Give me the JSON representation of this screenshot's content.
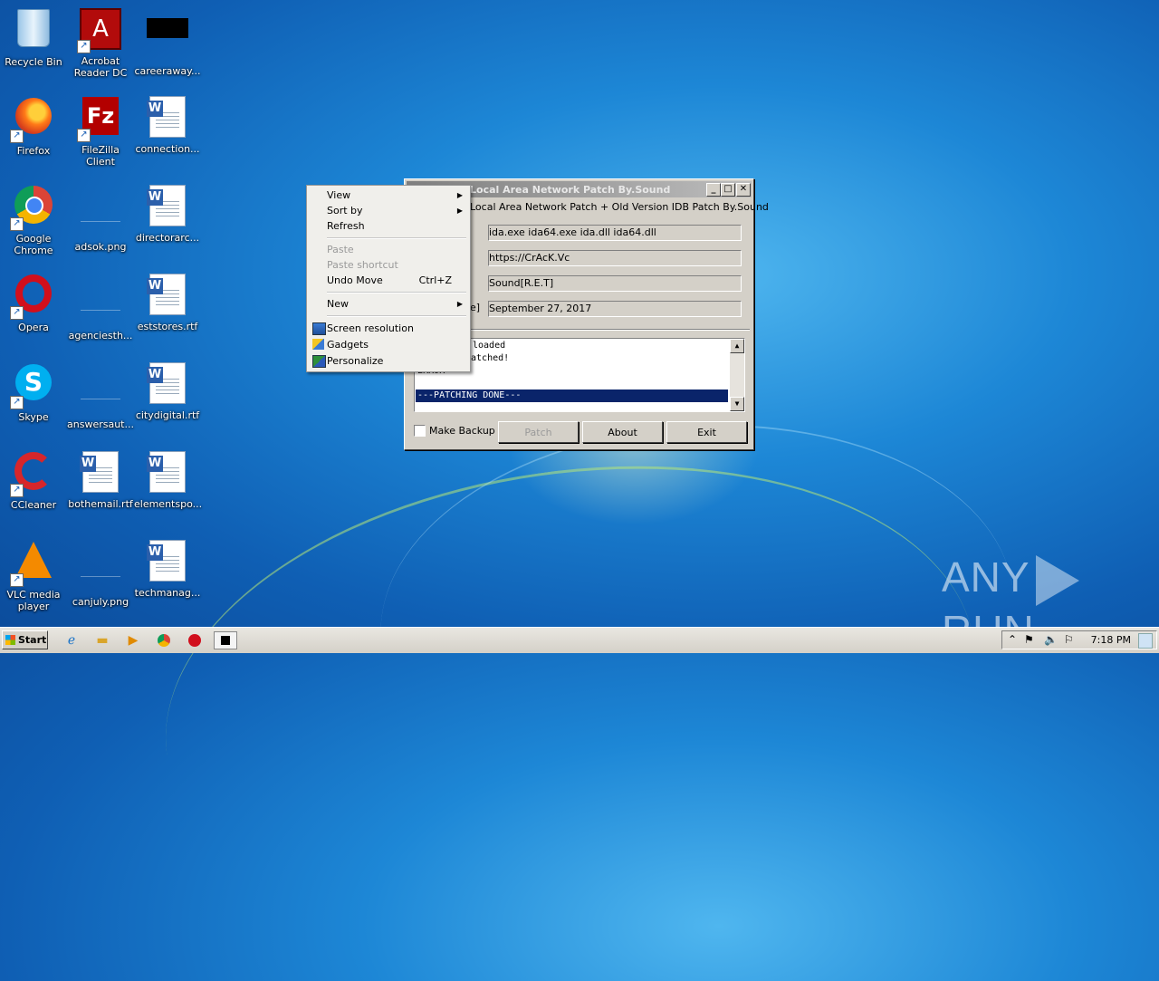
{
  "desktop": {
    "icons": [
      {
        "label": "Recycle Bin"
      },
      {
        "label": "Acrobat Reader DC"
      },
      {
        "label": "careeraway..."
      },
      {
        "label": "Firefox"
      },
      {
        "label": "FileZilla Client"
      },
      {
        "label": "connection..."
      },
      {
        "label": "Google Chrome"
      },
      {
        "label": "adsok.png"
      },
      {
        "label": "directorarc..."
      },
      {
        "label": "Opera"
      },
      {
        "label": "agenciesth..."
      },
      {
        "label": "eststores.rtf"
      },
      {
        "label": "Skype"
      },
      {
        "label": "answersaut..."
      },
      {
        "label": "citydigital.rtf"
      },
      {
        "label": "CCleaner"
      },
      {
        "label": "bothemail.rtf"
      },
      {
        "label": "elementspo..."
      },
      {
        "label": "VLC media player"
      },
      {
        "label": "canjuly.png"
      },
      {
        "label": "techmanag..."
      }
    ]
  },
  "patch_window": {
    "title": "Local  Area Network Patch By.Sound",
    "subtitle": "Local  Area Network Patch + Old Version IDB Patch By.Sound",
    "fields": [
      {
        "label": "",
        "value": "ida.exe ida64.exe ida.dll ida64.dll"
      },
      {
        "label": "",
        "value": "https://CrAcK.Vc"
      },
      {
        "label": "",
        "value": "Sound[R.E.T]"
      },
      {
        "label": "e]",
        "value": "September 27, 2017"
      }
    ],
    "log": [
      "loaded",
      "patched!",
      "ERROR",
      "---PATCHING DONE---"
    ],
    "make_backup_label": "Make Backup",
    "buttons": {
      "patch": "Patch",
      "about": "About",
      "exit": "Exit"
    }
  },
  "context_menu": {
    "view": "View",
    "sort_by": "Sort by",
    "refresh": "Refresh",
    "paste": "Paste",
    "paste_shortcut": "Paste shortcut",
    "undo_move": "Undo Move",
    "undo_shortcut": "Ctrl+Z",
    "new": "New",
    "screen_resolution": "Screen resolution",
    "gadgets": "Gadgets",
    "personalize": "Personalize"
  },
  "taskbar": {
    "start_label": "Start",
    "clock": "7:18 PM"
  },
  "watermark": {
    "left": "ANY",
    "right": "RUN"
  }
}
